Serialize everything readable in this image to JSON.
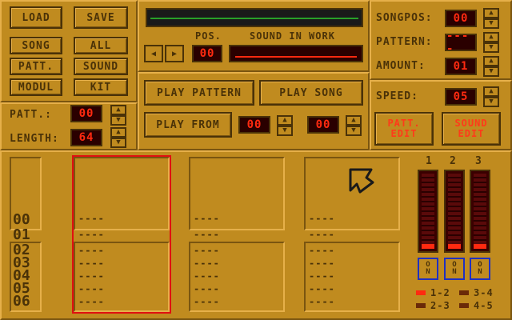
{
  "file_buttons": {
    "load": "LOAD",
    "save": "SAVE",
    "song": "SONG",
    "all": "ALL",
    "patt": "PATT.",
    "sound": "SOUND",
    "modul": "MODUL",
    "kit": "KIT"
  },
  "patt_label": "PATT.:",
  "patt_value": "00",
  "length_label": "LENGTH:",
  "length_value": "64",
  "pos_label": "POS.",
  "pos_value": "00",
  "sound_in_work_label": "SOUND IN WORK",
  "play": {
    "pattern": "PLAY PATTERN",
    "song": "PLAY SONG",
    "from": "PLAY FROM",
    "from_a": "00",
    "from_b": "00"
  },
  "songpos_label": "SONGPOS:",
  "songpos_value": "00",
  "pattern_label": "PATTERN:",
  "pattern_value": "----",
  "amount_label": "AMOUNT:",
  "amount_value": "01",
  "speed_label": "SPEED:",
  "speed_value": "05",
  "patt_edit": "PATT. EDIT",
  "sound_edit": "SOUND EDIT",
  "rows": [
    "00",
    "01",
    "02",
    "03",
    "04",
    "05",
    "06"
  ],
  "note_placeholder": "----",
  "channels": [
    "1",
    "2",
    "3"
  ],
  "on_label_top": "O",
  "on_label_bottom": "N",
  "legend": {
    "a": "1-2",
    "b": "3-4",
    "c": "2-3",
    "d": "4-5"
  },
  "colors": {
    "led_text": "#ff2a10",
    "led_bg": "#2a0000",
    "panel": "#c08b1f",
    "dark": "#4a3208"
  }
}
